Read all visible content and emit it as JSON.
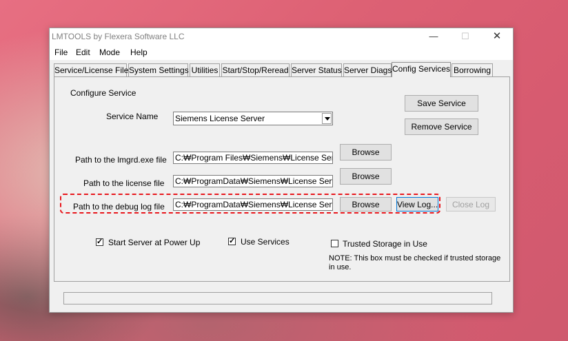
{
  "window": {
    "title": "LMTOOLS by Flexera Software LLC"
  },
  "menu": [
    "File",
    "Edit",
    "Mode",
    "Help"
  ],
  "tabs": [
    {
      "label": "Service/License File"
    },
    {
      "label": "System Settings"
    },
    {
      "label": "Utilities"
    },
    {
      "label": "Start/Stop/Reread"
    },
    {
      "label": "Server Status"
    },
    {
      "label": "Server Diags"
    },
    {
      "label": "Config Services"
    },
    {
      "label": "Borrowing"
    }
  ],
  "config": {
    "heading": "Configure Service",
    "service_name_label": "Service Name",
    "service_name_value": "Siemens License Server",
    "save_service": "Save Service",
    "remove_service": "Remove Service",
    "lmgrd_label": "Path to the lmgrd.exe file",
    "lmgrd_value": "C:₩Program Files₩Siemens₩License Server₩",
    "license_label": "Path to the license file",
    "license_value": "C:₩ProgramData₩Siemens₩License Server₩",
    "debug_label": "Path to the debug log file",
    "debug_value": "C:₩ProgramData₩Siemens₩License Server₩",
    "browse": "Browse",
    "view_log": "View Log...",
    "close_log": "Close Log",
    "start_power_up": "Start Server at Power Up",
    "use_services": "Use Services",
    "trusted_storage": "Trusted Storage in Use",
    "note": "NOTE: This box must be checked if trusted storage in use."
  },
  "checkboxes": {
    "start_power_up": true,
    "use_services": true,
    "trusted_storage": false
  },
  "colors": {
    "highlight": "#e8151b",
    "focus": "#0078d7"
  }
}
